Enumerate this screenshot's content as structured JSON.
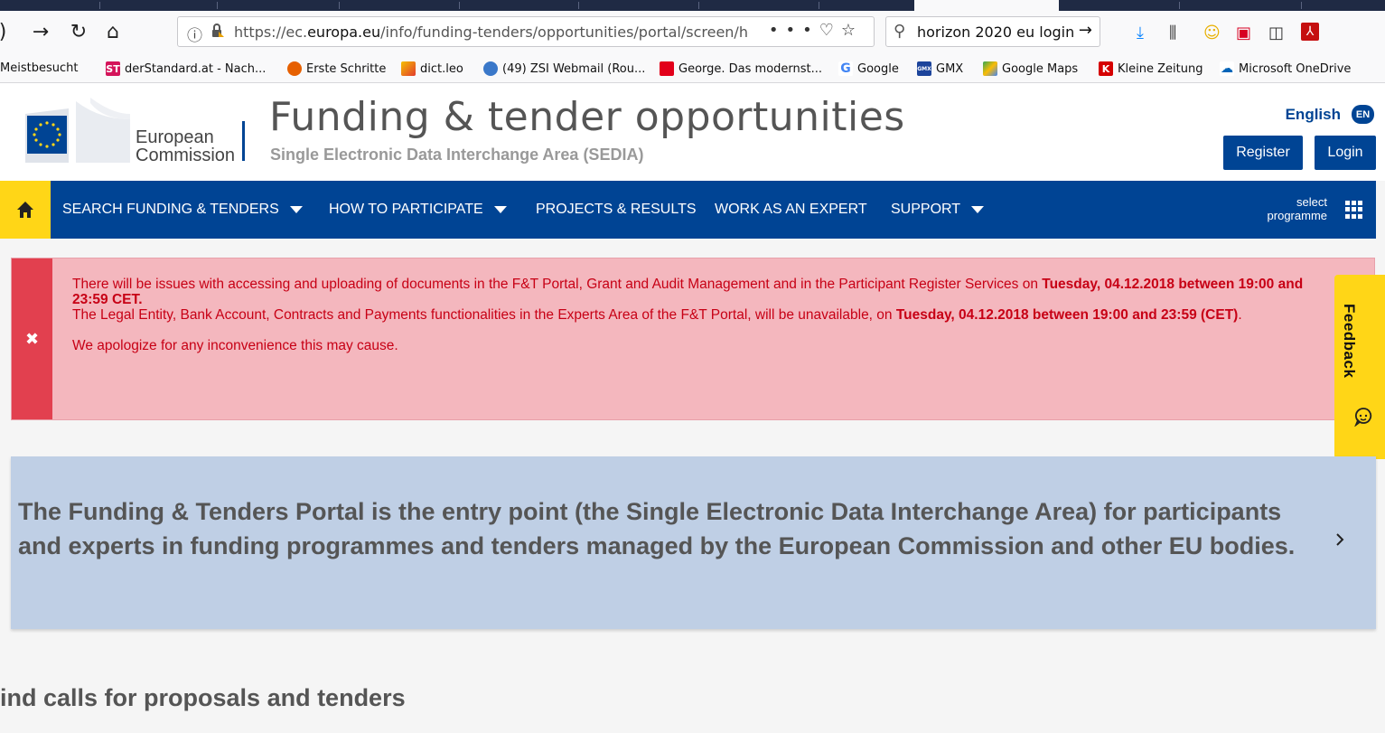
{
  "browser": {
    "url_prefix": "https://ec.",
    "url_domain": "europa.eu",
    "url_path": "/info/funding-tenders/opportunities/portal/screen/ho",
    "search_text": "horizon 2020 eu login",
    "bookmarks": [
      {
        "label": "Meistbesucht"
      },
      {
        "label": "derStandard.at - Nach...",
        "icon": "ST"
      },
      {
        "label": "Erste Schritte"
      },
      {
        "label": "dict.leo"
      },
      {
        "label": "(49) ZSI Webmail (Rou..."
      },
      {
        "label": "George. Das modernst..."
      },
      {
        "label": "Google",
        "icon": "G"
      },
      {
        "label": "GMX",
        "icon": "GMX"
      },
      {
        "label": "Google Maps"
      },
      {
        "label": "Kleine Zeitung",
        "icon": "K"
      },
      {
        "label": "Microsoft OneDrive"
      }
    ]
  },
  "header": {
    "logo_text_1": "European",
    "logo_text_2": "Commission",
    "title": "Funding & tender opportunities",
    "subtitle": "Single Electronic Data Interchange Area (SEDIA)",
    "language": "English",
    "language_code": "EN",
    "register_label": "Register",
    "login_label": "Login"
  },
  "nav": {
    "items": [
      {
        "label": "SEARCH FUNDING & TENDERS"
      },
      {
        "label": "HOW TO PARTICIPATE"
      },
      {
        "label": "PROJECTS & RESULTS"
      },
      {
        "label": "WORK AS AN EXPERT"
      },
      {
        "label": "SUPPORT"
      }
    ],
    "select_line1": "select",
    "select_line2": "programme"
  },
  "alert": {
    "line1_text": "There will be issues with accessing and uploading of documents in the F&T Portal, Grant and Audit Management and in the Participant Register Services on ",
    "line1_bold": "Tuesday, 04.12.2018 between 19:00 and 23:59 CET.",
    "line2_text": "The Legal Entity, Bank Account, Contracts and Payments functionalities in the Experts Area of the F&T Portal, will be unavailable, on ",
    "line2_bold": "Tuesday, 04.12.2018 between 19:00 and 23:59 (CET)",
    "line2_end": ".",
    "apology": "We apologize for any inconvenience this may cause."
  },
  "feedback": {
    "label": "Feedback"
  },
  "intro": {
    "text": "The Funding & Tenders Portal is the entry point (the Single Electronic Data Interchange Area) for participants and experts in funding programmes and tenders managed by the European Commission and other EU bodies."
  },
  "section": {
    "heading": "ind calls for proposals and tenders"
  },
  "colors": {
    "ec_blue": "#004494",
    "ec_yellow": "#ffd617",
    "alert_bg": "#f4b7be",
    "alert_text": "#c70015",
    "intro_bg": "#bfcfe5"
  }
}
